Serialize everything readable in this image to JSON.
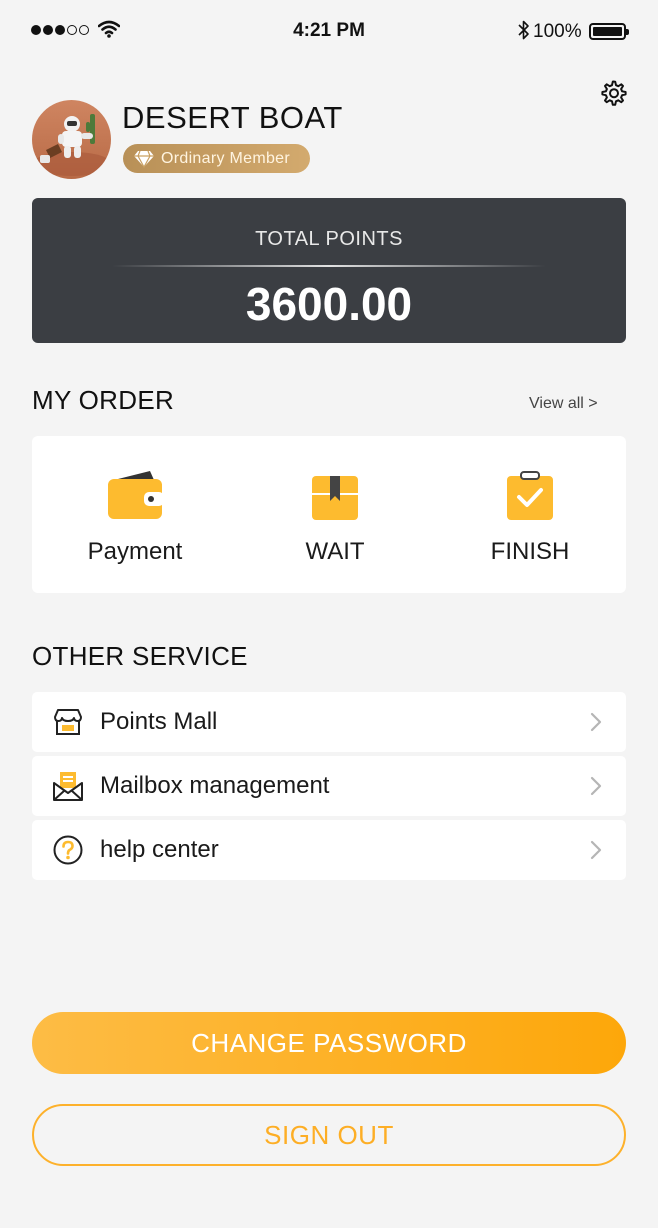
{
  "status_bar": {
    "time": "4:21 PM",
    "battery_percent": "100%",
    "signal_bars_filled": 3,
    "signal_bars_total": 5,
    "icons": [
      "signal-dots-icon",
      "wifi-icon",
      "bluetooth-icon",
      "battery-icon"
    ]
  },
  "header": {
    "settings_icon": "gear-icon"
  },
  "profile": {
    "name": "DESERT BOAT",
    "membership": "Ordinary Member",
    "badge_icon": "diamond-icon"
  },
  "points": {
    "label": "TOTAL POINTS",
    "value": "3600.00"
  },
  "orders": {
    "title": "MY ORDER",
    "view_all": "View all >",
    "items": [
      {
        "label": "Payment",
        "icon": "wallet-icon"
      },
      {
        "label": "WAIT",
        "icon": "package-box-icon"
      },
      {
        "label": "FINISH",
        "icon": "clipboard-check-icon"
      }
    ]
  },
  "services": {
    "title": "OTHER SERVICE",
    "items": [
      {
        "label": "Points Mall",
        "icon": "store-icon"
      },
      {
        "label": "Mailbox management",
        "icon": "mailbox-icon"
      },
      {
        "label": "help center",
        "icon": "help-question-icon"
      }
    ]
  },
  "actions": {
    "change_password": "CHANGE PASSWORD",
    "sign_out": "SIGN OUT"
  },
  "colors": {
    "accent": "#FDA70A",
    "accent_light": "#FDBC45",
    "card_dark": "#3B3E43",
    "badge_gold": "#C49E63",
    "background": "#F4F4F4"
  }
}
